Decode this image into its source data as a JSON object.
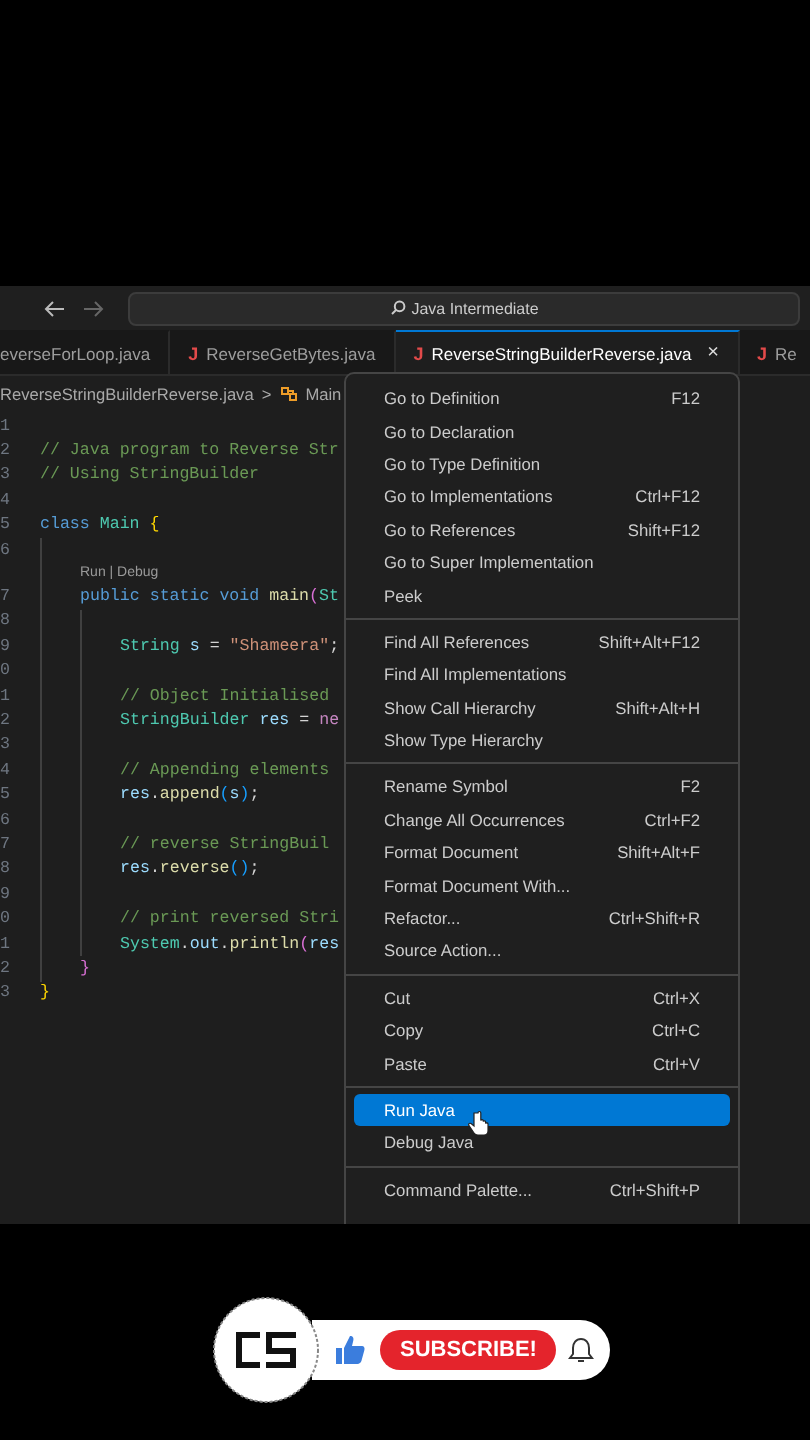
{
  "title_bar": {
    "search": "Java Intermediate"
  },
  "tabs": [
    {
      "label": "everseForLoop.java",
      "selected": false
    },
    {
      "label": "ReverseGetBytes.java",
      "selected": false,
      "icon": "J"
    },
    {
      "label": "ReverseStringBuilderReverse.java",
      "selected": true,
      "icon": "J",
      "close": "×"
    },
    {
      "label": "Re",
      "selected": false,
      "icon": "J"
    }
  ],
  "breadcrumb": {
    "file": "ReverseStringBuilderReverse.java",
    "separator": ">",
    "symbol": "Main"
  },
  "editor": {
    "lines": [
      {
        "number": "1"
      },
      {
        "number": "2",
        "tokens": [
          {
            "kind": "comment",
            "text": "// Java program to Reverse Str"
          }
        ]
      },
      {
        "number": "3",
        "tokens": [
          {
            "kind": "comment",
            "text": "// Using StringBuilder"
          }
        ]
      },
      {
        "number": "4"
      },
      {
        "number": "5",
        "tokens": [
          {
            "kind": "keyword",
            "text": "class "
          },
          {
            "kind": "type",
            "text": "Main "
          },
          {
            "kind": "bracket",
            "text": "{"
          }
        ],
        "children": [
          {
            "number": "6"
          },
          {
            "kind": "codelens",
            "tokens": [
              {
                "kind": "lens",
                "text": "Run | Debug"
              }
            ]
          },
          {
            "number": "7",
            "tokens": [
              {
                "kind": "keyword",
                "text": "public static void "
              },
              {
                "kind": "function",
                "text": "main"
              },
              {
                "kind": "bracket2",
                "text": "("
              },
              {
                "kind": "type",
                "text": "St"
              }
            ],
            "children": [
              {
                "number": "8"
              },
              {
                "number": "9",
                "tokens": [
                  {
                    "kind": "type",
                    "text": "String "
                  },
                  {
                    "kind": "variable",
                    "text": "s "
                  },
                  {
                    "kind": "plain",
                    "text": "= "
                  },
                  {
                    "kind": "string",
                    "text": "\"Shameera\""
                  },
                  {
                    "kind": "plain",
                    "text": ";"
                  }
                ]
              },
              {
                "number": "0"
              },
              {
                "number": "1",
                "tokens": [
                  {
                    "kind": "comment",
                    "text": "// Object Initialised"
                  }
                ]
              },
              {
                "number": "2",
                "tokens": [
                  {
                    "kind": "type",
                    "text": "StringBuilder "
                  },
                  {
                    "kind": "variable",
                    "text": "res "
                  },
                  {
                    "kind": "plain",
                    "text": "= "
                  },
                  {
                    "kind": "control",
                    "text": "ne"
                  }
                ]
              },
              {
                "number": "3"
              },
              {
                "number": "4",
                "tokens": [
                  {
                    "kind": "comment",
                    "text": "// Appending elements"
                  }
                ]
              },
              {
                "number": "5",
                "tokens": [
                  {
                    "kind": "variable",
                    "text": "res"
                  },
                  {
                    "kind": "plain",
                    "text": "."
                  },
                  {
                    "kind": "function",
                    "text": "append"
                  },
                  {
                    "kind": "bracket3",
                    "text": "("
                  },
                  {
                    "kind": "variable",
                    "text": "s"
                  },
                  {
                    "kind": "bracket3",
                    "text": ")"
                  },
                  {
                    "kind": "plain",
                    "text": ";"
                  }
                ]
              },
              {
                "number": "6"
              },
              {
                "number": "7",
                "tokens": [
                  {
                    "kind": "comment",
                    "text": "// reverse StringBuil"
                  }
                ]
              },
              {
                "number": "8",
                "tokens": [
                  {
                    "kind": "variable",
                    "text": "res"
                  },
                  {
                    "kind": "plain",
                    "text": "."
                  },
                  {
                    "kind": "function",
                    "text": "reverse"
                  },
                  {
                    "kind": "bracket3",
                    "text": "()"
                  },
                  {
                    "kind": "plain",
                    "text": ";"
                  }
                ]
              },
              {
                "number": "9"
              },
              {
                "number": "0",
                "tokens": [
                  {
                    "kind": "comment",
                    "text": "// print reversed Stri"
                  }
                ]
              },
              {
                "number": "1",
                "tokens": [
                  {
                    "kind": "type",
                    "text": "System"
                  },
                  {
                    "kind": "plain",
                    "text": "."
                  },
                  {
                    "kind": "variable",
                    "text": "out"
                  },
                  {
                    "kind": "plain",
                    "text": "."
                  },
                  {
                    "kind": "function",
                    "text": "println"
                  },
                  {
                    "kind": "bracket2",
                    "text": "("
                  },
                  {
                    "kind": "variable",
                    "text": "res"
                  }
                ]
              }
            ]
          },
          {
            "number": "2",
            "tokens": [
              {
                "kind": "bracket2",
                "text": "}"
              }
            ]
          }
        ]
      },
      {
        "number": "3",
        "tokens": [
          {
            "kind": "bracket",
            "text": "}"
          }
        ]
      }
    ]
  },
  "context_menu": [
    {
      "kind": "item",
      "label": "Go to Definition",
      "shortcut": "F12",
      "selected": false
    },
    {
      "kind": "item",
      "label": "Go to Declaration",
      "selected": false
    },
    {
      "kind": "item",
      "label": "Go to Type Definition",
      "selected": false
    },
    {
      "kind": "item",
      "label": "Go to Implementations",
      "shortcut": "Ctrl+F12",
      "selected": false
    },
    {
      "kind": "item",
      "label": "Go to References",
      "shortcut": "Shift+F12",
      "selected": false
    },
    {
      "kind": "item",
      "label": "Go to Super Implementation",
      "selected": false
    },
    {
      "kind": "item",
      "label": "Peek",
      "selected": false
    },
    {
      "kind": "separator"
    },
    {
      "kind": "item",
      "label": "Find All References",
      "shortcut": "Shift+Alt+F12",
      "selected": false
    },
    {
      "kind": "item",
      "label": "Find All Implementations",
      "selected": false
    },
    {
      "kind": "item",
      "label": "Show Call Hierarchy",
      "shortcut": "Shift+Alt+H",
      "selected": false
    },
    {
      "kind": "item",
      "label": "Show Type Hierarchy",
      "selected": false
    },
    {
      "kind": "separator"
    },
    {
      "kind": "item",
      "label": "Rename Symbol",
      "shortcut": "F2",
      "selected": false
    },
    {
      "kind": "item",
      "label": "Change All Occurrences",
      "shortcut": "Ctrl+F2",
      "selected": false
    },
    {
      "kind": "item",
      "label": "Format Document",
      "shortcut": "Shift+Alt+F",
      "selected": false
    },
    {
      "kind": "item",
      "label": "Format Document With...",
      "selected": false
    },
    {
      "kind": "item",
      "label": "Refactor...",
      "shortcut": "Ctrl+Shift+R",
      "selected": false
    },
    {
      "kind": "item",
      "label": "Source Action...",
      "selected": false
    },
    {
      "kind": "separator"
    },
    {
      "kind": "item",
      "label": "Cut",
      "shortcut": "Ctrl+X",
      "selected": false
    },
    {
      "kind": "item",
      "label": "Copy",
      "shortcut": "Ctrl+C",
      "selected": false
    },
    {
      "kind": "item",
      "label": "Paste",
      "shortcut": "Ctrl+V",
      "selected": false
    },
    {
      "kind": "separator"
    },
    {
      "kind": "item",
      "label": "Run Java",
      "selected": true
    },
    {
      "kind": "item",
      "label": "Debug Java",
      "selected": false
    },
    {
      "kind": "separator"
    },
    {
      "kind": "item",
      "label": "Command Palette...",
      "shortcut": "Ctrl+Shift+P",
      "selected": false
    }
  ],
  "subscribe_bar": {
    "button": "SUBSCRIBE!"
  }
}
